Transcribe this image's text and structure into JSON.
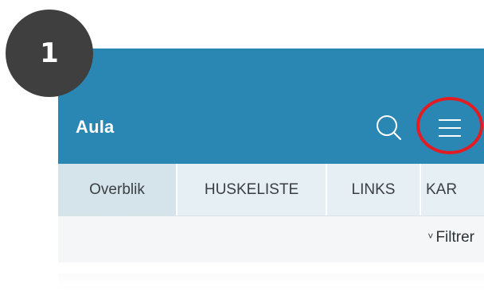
{
  "step": {
    "number": "1"
  },
  "app": {
    "brand": "Aula",
    "header_color": "#2a87b3"
  },
  "toolbar": {
    "search_icon": "search-icon",
    "menu_icon": "hamburger-menu-icon"
  },
  "tabs": [
    {
      "label": "Overblik",
      "active": true
    },
    {
      "label": "HUSKELISTE",
      "active": false
    },
    {
      "label": "LINKS",
      "active": false
    },
    {
      "label": "KAR",
      "active": false
    }
  ],
  "filter": {
    "label": "Filtrer",
    "chevron": "˅"
  },
  "highlight": {
    "color": "#e31b23",
    "target": "hamburger-menu-icon"
  }
}
